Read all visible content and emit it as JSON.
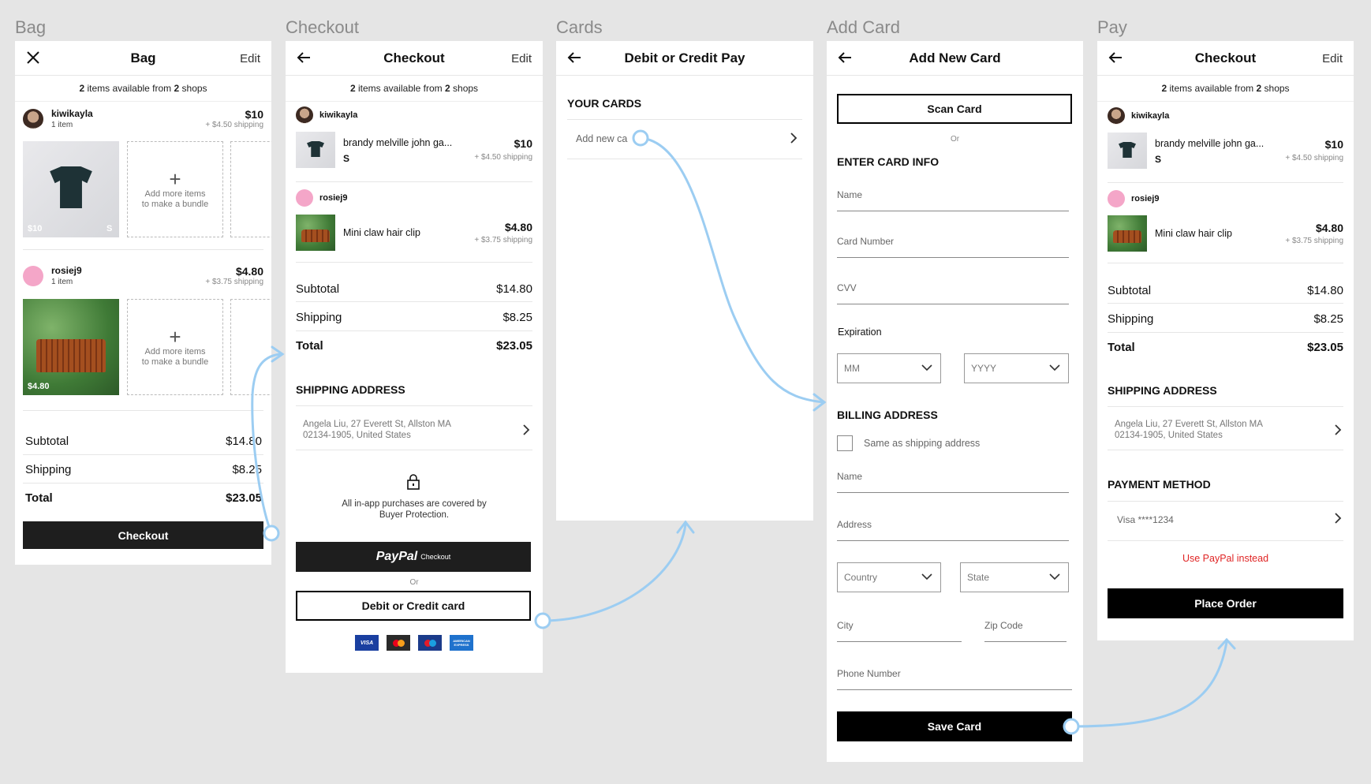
{
  "labels": {
    "bag": "Bag",
    "checkout": "Checkout",
    "cards": "Cards",
    "add_card": "Add Card",
    "pay": "Pay"
  },
  "common": {
    "items_count": "2",
    "items_mid": " items available from ",
    "shops_count": "2",
    "shops_word": " shops",
    "edit": "Edit",
    "seller1": "kiwikayla",
    "seller2": "rosiej9",
    "item1_name": "brandy melville john ga...",
    "item1_size": "S",
    "item1_price": "$10",
    "item1_ship": "+ $4.50 shipping",
    "item2_name": "Mini claw hair clip",
    "item2_price": "$4.80",
    "item2_ship": "+ $3.75 shipping",
    "subtotal_label": "Subtotal",
    "subtotal": "$14.80",
    "shipping_label": "Shipping",
    "shipping": "$8.25",
    "total_label": "Total",
    "total": "$23.05",
    "ship_addr_title": "SHIPPING ADDRESS",
    "address_line1": "Angela Liu, 27 Everett St, Allston MA",
    "address_line2": "02134-1905, United States"
  },
  "bag": {
    "title": "Bag",
    "one_item": "1 item",
    "price1_tag": "$10",
    "size_tag": "S",
    "price2_tag": "$4.80",
    "bundle_line1": "Add more items",
    "bundle_line2": "to make a bundle",
    "checkout_button": "Checkout"
  },
  "checkout": {
    "title": "Checkout",
    "buyer_protection_1": "All in-app purchases are covered by",
    "buyer_protection_2": "Buyer Protection.",
    "paypal_logo": "PayPal",
    "paypal_sub": "Checkout",
    "or": "Or",
    "card_button": "Debit or Credit card",
    "card_logos": [
      "VISA",
      "mastercard",
      "maestro",
      "AMERICAN EXPRESS"
    ]
  },
  "cards": {
    "title": "Debit or Credit Pay",
    "your_cards": "YOUR CARDS",
    "add_new": "Add new ca"
  },
  "add_card": {
    "title": "Add New Card",
    "scan": "Scan Card",
    "or": "Or",
    "enter_info": "ENTER CARD INFO",
    "name": "Name",
    "card_number": "Card Number",
    "cvv": "CVV",
    "expiration": "Expiration",
    "mm": "MM",
    "yyyy": "YYYY",
    "billing": "BILLING ADDRESS",
    "same_as": "Same as shipping address",
    "b_name": "Name",
    "address": "Address",
    "country": "Country",
    "state": "State",
    "city": "City",
    "zip": "Zip Code",
    "phone": "Phone Number",
    "save": "Save Card"
  },
  "pay": {
    "title": "Checkout",
    "payment_method": "PAYMENT METHOD",
    "card": "Visa ****1234",
    "paypal_instead": "Use PayPal instead",
    "place_order": "Place Order"
  },
  "colors": {
    "flow": "#9ccdf2",
    "paypal_red": "#e02424",
    "black": "#000000"
  }
}
